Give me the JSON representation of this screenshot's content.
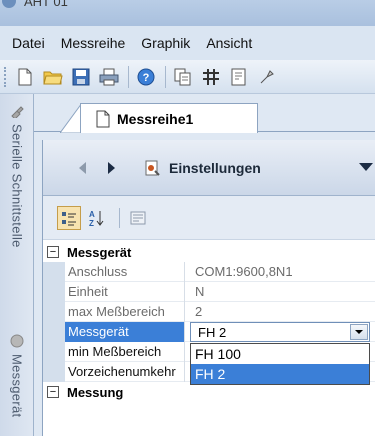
{
  "window": {
    "title": "AHT 01"
  },
  "menu": [
    "Datei",
    "Messreihe",
    "Graphik",
    "Ansicht"
  ],
  "toolbar": {
    "icons": [
      "new-document-icon",
      "open-folder-icon",
      "save-icon",
      "print-icon",
      "help-icon",
      "copy-icon",
      "grid-icon",
      "export-icon",
      "settings-icon"
    ]
  },
  "side_tabs": [
    "Serielle Schnittstelle",
    "Messgerät"
  ],
  "document_tab": {
    "label": "Messreihe1"
  },
  "nav": {
    "title": "Einstellungen"
  },
  "categories": [
    {
      "label": "Messgerät",
      "toggle": "−",
      "properties": [
        {
          "name": "Anschluss",
          "value": "COM1:9600,8N1"
        },
        {
          "name": "Einheit",
          "value": "N"
        },
        {
          "name": "max Meßbereich",
          "value": "2"
        },
        {
          "name": "Messgerät",
          "value": "FH 2"
        },
        {
          "name": "min Meßbereich",
          "value": ""
        },
        {
          "name": "Vorzeichenumkehr",
          "value": ""
        }
      ]
    },
    {
      "label": "Messung",
      "toggle": "−"
    }
  ],
  "dropdown": {
    "options": [
      "FH 100",
      "FH 2"
    ],
    "highlighted": "FH 2"
  },
  "colors": {
    "selection": "#3b7fd7",
    "panel_border": "#8da4c1"
  }
}
